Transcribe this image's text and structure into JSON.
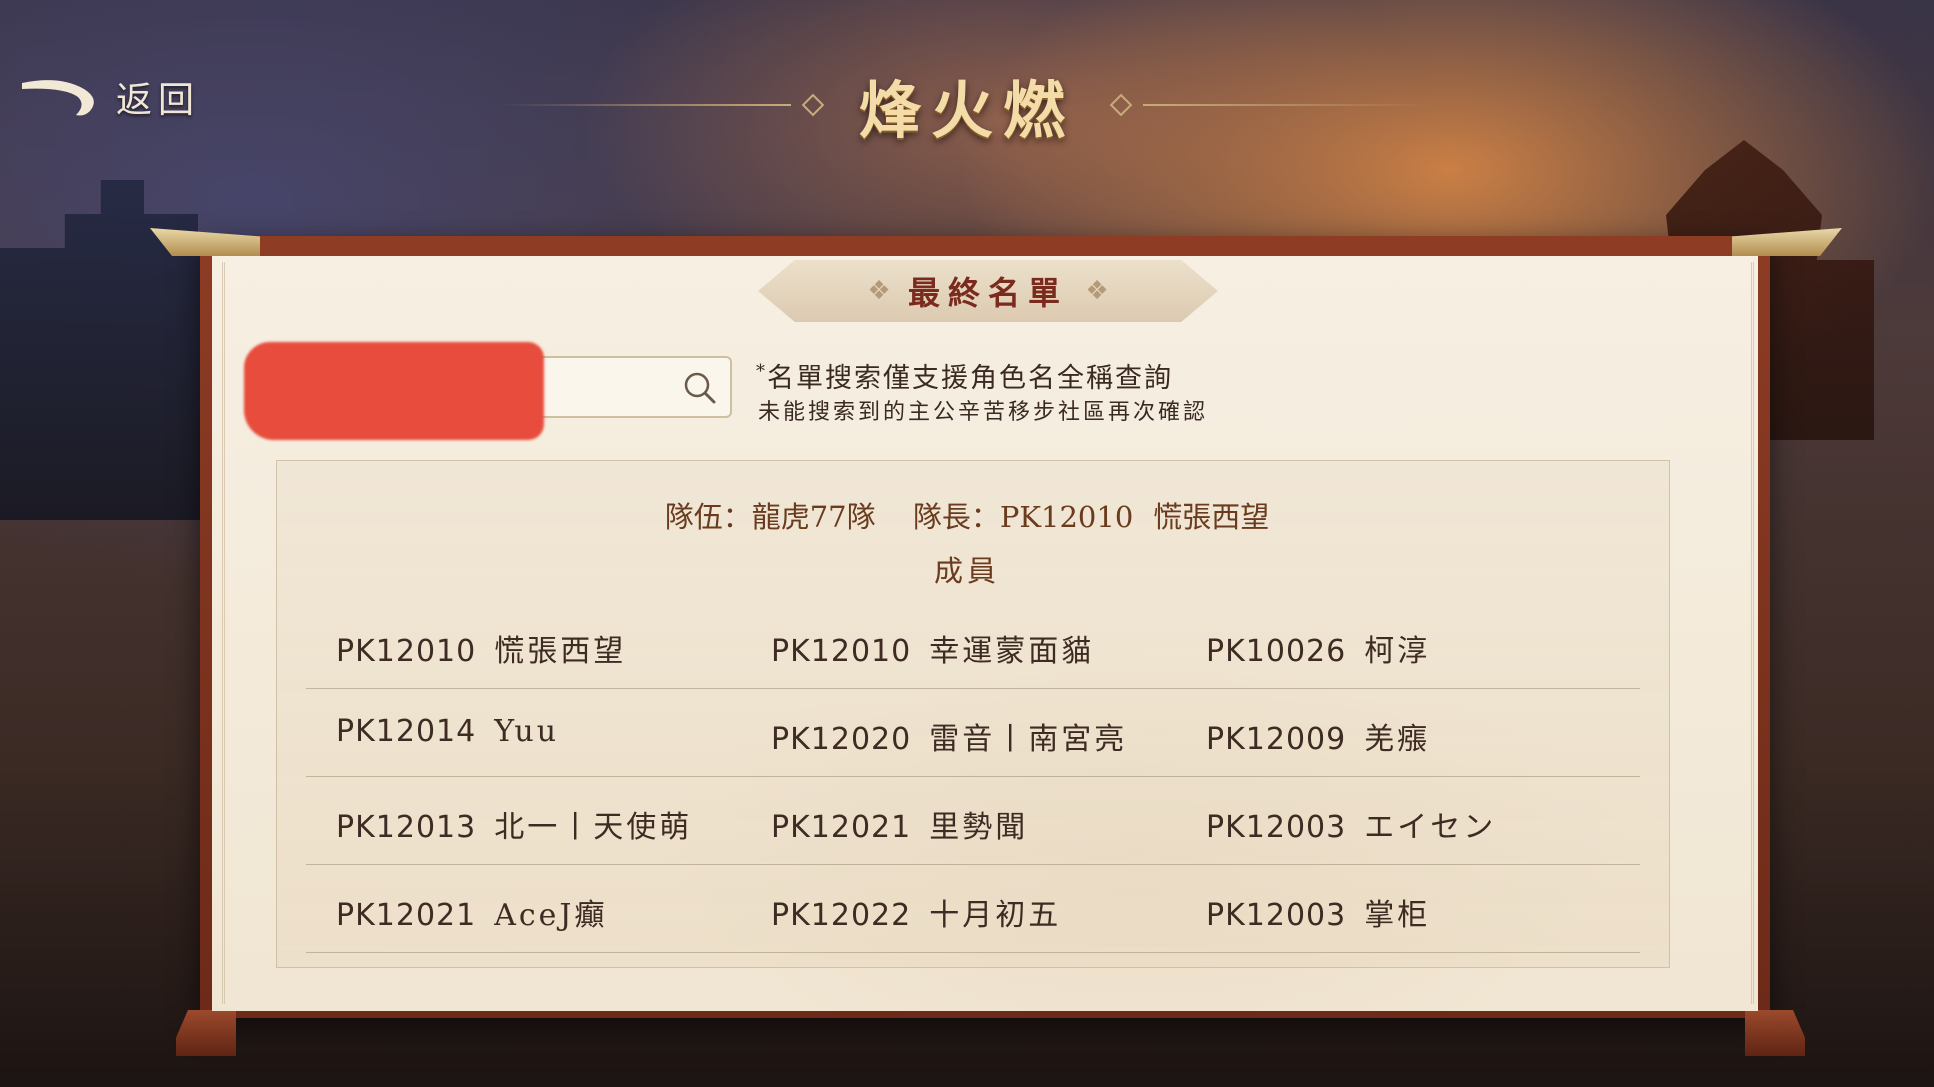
{
  "header": {
    "back_label": "返回",
    "title": "烽火燃"
  },
  "banner": {
    "title": "最終名單"
  },
  "search": {
    "value": "",
    "note_line1": "名單搜索僅支援角色名全稱查詢",
    "note_line2": "未能搜索到的主公辛苦移步社區再次確認"
  },
  "team": {
    "team_label": "隊伍：",
    "team_name": "龍虎77隊",
    "captain_label": "隊長：",
    "captain_id": "PK12010",
    "captain_name": "慌張西望",
    "members_label": "成員"
  },
  "members": [
    [
      {
        "id": "PK12010",
        "name": "慌張西望"
      },
      {
        "id": "PK12010",
        "name": "幸運蒙面貓"
      },
      {
        "id": "PK10026",
        "name": "柯淳"
      }
    ],
    [
      {
        "id": "PK12014",
        "name": "Yuu"
      },
      {
        "id": "PK12020",
        "name": "雷音丨南宮亮"
      },
      {
        "id": "PK12009",
        "name": "羌瘬"
      }
    ],
    [
      {
        "id": "PK12013",
        "name": "北一丨天使萌"
      },
      {
        "id": "PK12021",
        "name": "里勢聞"
      },
      {
        "id": "PK12003",
        "name": "エイセン"
      }
    ],
    [
      {
        "id": "PK12021",
        "name": "AceJ癲"
      },
      {
        "id": "PK12022",
        "name": "十月初五"
      },
      {
        "id": "PK12003",
        "name": "掌柜"
      }
    ]
  ],
  "colors": {
    "title_gold": "#f3dca8",
    "banner_text": "#7a2b1e",
    "redaction": "#e74c3c",
    "frame": "#8e3c24"
  }
}
